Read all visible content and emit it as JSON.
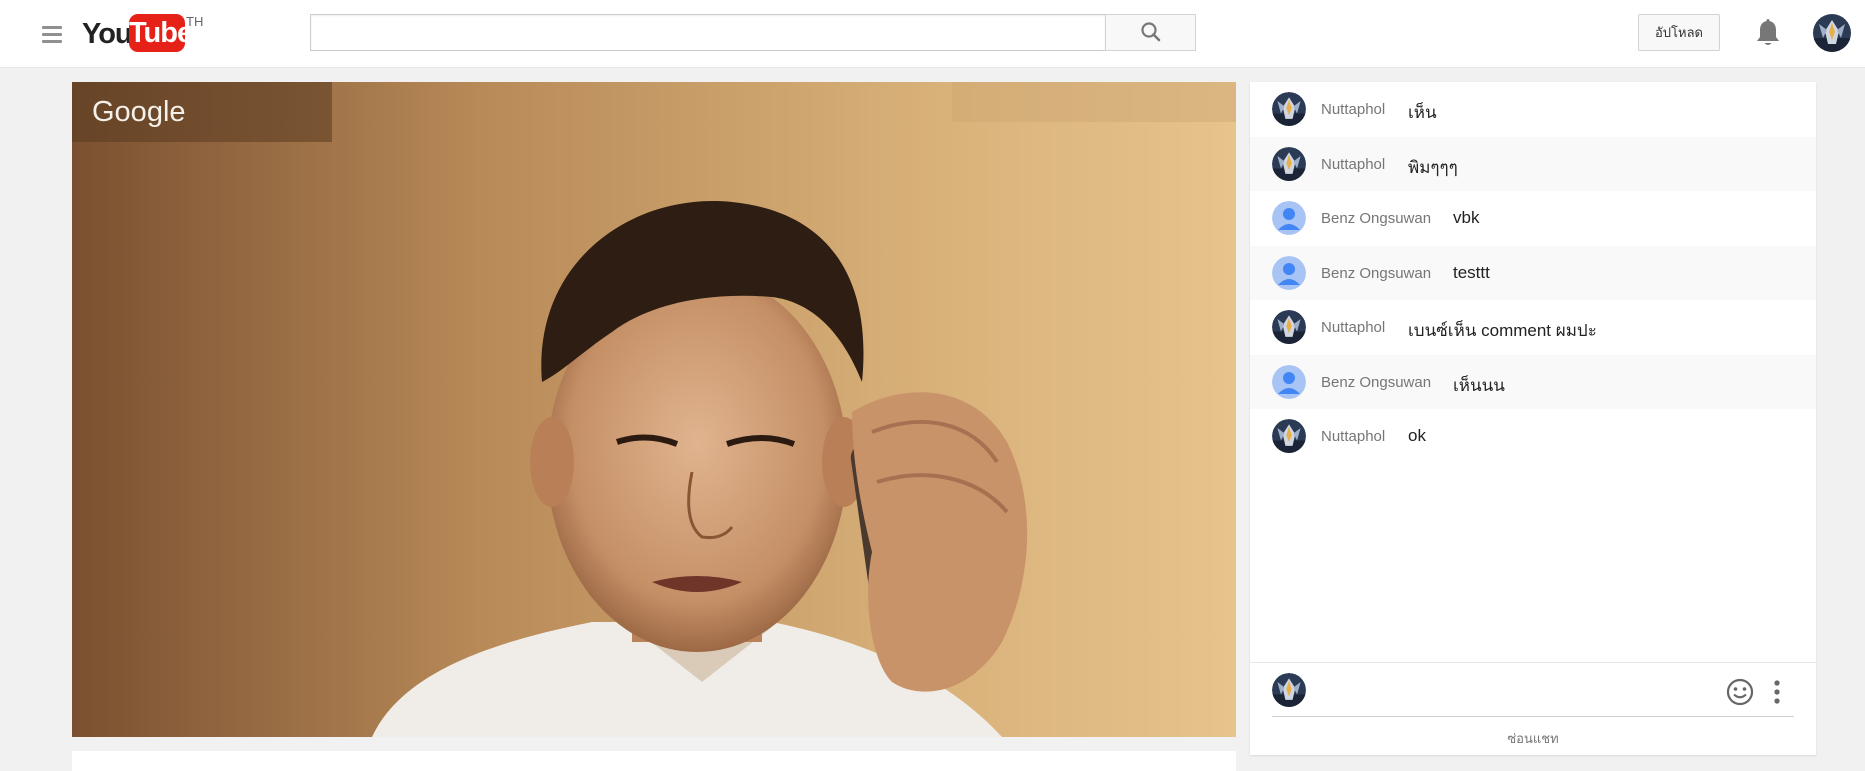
{
  "header": {
    "logo_you": "You",
    "logo_tube": "Tube",
    "logo_country": "TH",
    "search_value": "",
    "upload_label": "อัปโหลด"
  },
  "video": {
    "watermark": "Google"
  },
  "chat": {
    "messages": [
      {
        "author": "Nuttaphol",
        "text": "เห็น",
        "avatar": "robot-avatar"
      },
      {
        "author": "Nuttaphol",
        "text": "พิมๆๆๆ",
        "avatar": "robot-avatar"
      },
      {
        "author": "Benz Ongsuwan",
        "text": "vbk",
        "avatar": "default-avatar"
      },
      {
        "author": "Benz Ongsuwan",
        "text": "testtt",
        "avatar": "default-avatar"
      },
      {
        "author": "Nuttaphol",
        "text": "เบนซ์เห็น comment ผมปะ",
        "avatar": "robot-avatar"
      },
      {
        "author": "Benz Ongsuwan",
        "text": "เห็นนน",
        "avatar": "default-avatar"
      },
      {
        "author": "Nuttaphol",
        "text": "ok",
        "avatar": "robot-avatar"
      }
    ],
    "input_value": "",
    "hide_label": "ซ่อนแชท"
  },
  "colors": {
    "brand_red": "#e62117",
    "default_avatar_blue": "#4285f4",
    "page_bg": "#f1f1f1"
  }
}
